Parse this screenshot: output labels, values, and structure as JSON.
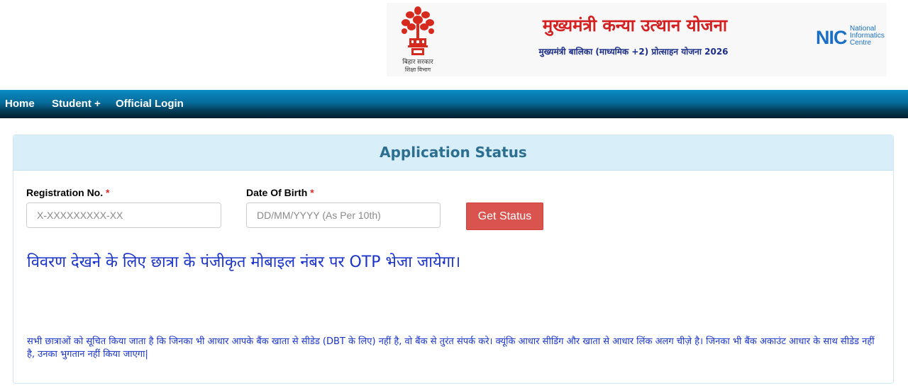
{
  "header": {
    "emblem_caption_1": "बिहार सरकार",
    "emblem_caption_2": "शिक्षा विभाग",
    "scheme_title": "मुख्यमंत्री कन्या उत्थान योजना",
    "scheme_subtitle": "मुख्यमंत्री बालिका (माध्यमिक +2) प्रोत्साहन योजना 2026",
    "nic_mark": "NIC",
    "nic_line1": "National",
    "nic_line2": "Informatics",
    "nic_line3": "Centre"
  },
  "nav": {
    "items": [
      {
        "label": "Home"
      },
      {
        "label": "Student +"
      },
      {
        "label": "Official Login"
      }
    ]
  },
  "panel": {
    "title": "Application Status",
    "registration_label": "Registration No.",
    "registration_placeholder": "X-XXXXXXXXX-XX",
    "registration_value": "",
    "dob_label": "Date Of Birth",
    "dob_placeholder": "DD/MM/YYYY (As Per 10th)",
    "dob_value": "",
    "required_mark": "*",
    "get_status_label": "Get Status",
    "otp_note": "विवरण देखने के लिए छात्रा के पंजीकृत मोबाइल नंबर पर OTP भेजा जायेगा।",
    "dbt_note": "सभी छात्राओं को सूचित किया जाता है कि जिनका भी आधार आपके बैंक खाता से सीडेड (DBT के लिए) नहीं है, वो बैंक से तुरंत संपर्क करे। क्यूंकि आधार सीडिंग और खाता से आधार लिंक अलग चीज़े है। जिनका भी बैंक अकाउंट आधार के साथ सीडेड नहीं है, उनका भुगतान नहीं किया जाएगा|"
  },
  "colors": {
    "accent_red": "#d9534f",
    "title_blue": "#2d6f91",
    "note_blue": "#1a34c9",
    "scheme_red": "#d42020",
    "nav_dark": "#043a55"
  }
}
